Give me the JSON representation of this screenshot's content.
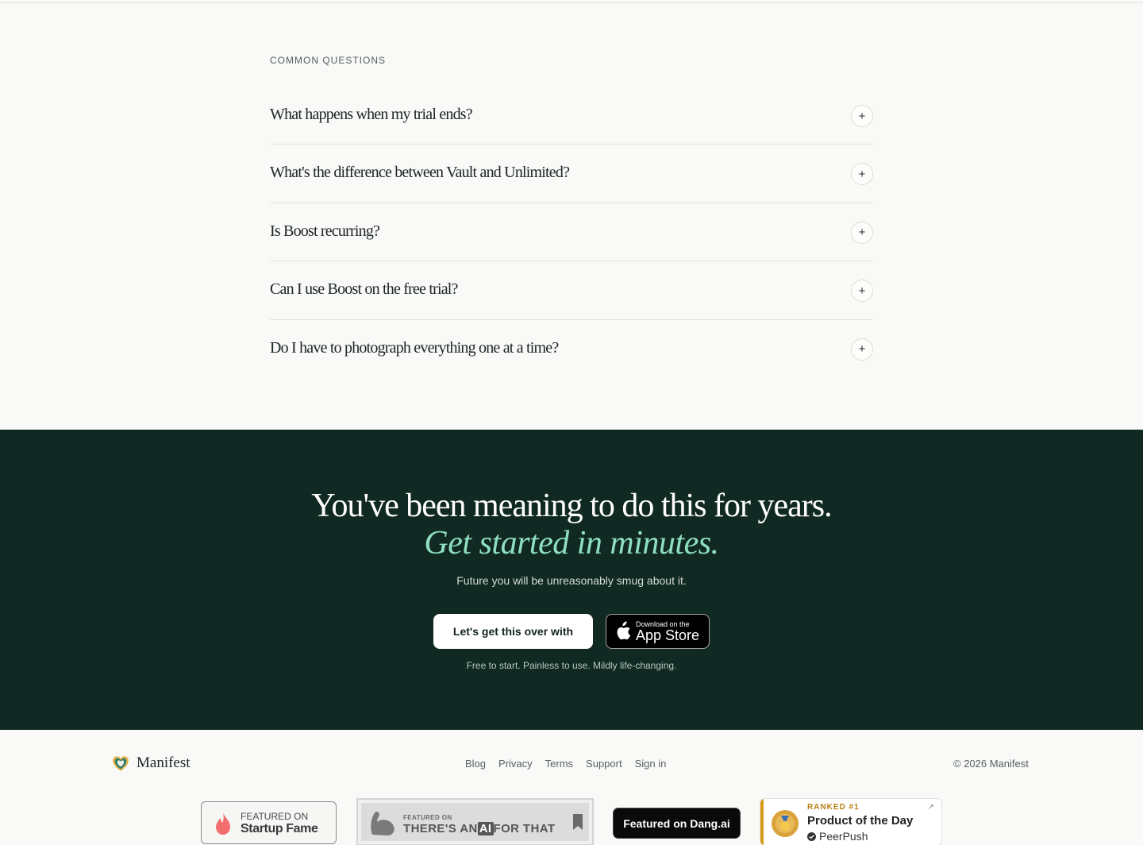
{
  "faq": {
    "kicker": "COMMON QUESTIONS",
    "items": [
      {
        "question": "What happens when my trial ends?"
      },
      {
        "question": "What's the difference between Vault and Unlimited?"
      },
      {
        "question": "Is Boost recurring?"
      },
      {
        "question": "Can I use Boost on the free trial?"
      },
      {
        "question": "Do I have to photograph everything one at a time?"
      }
    ],
    "toggle_glyph": "+"
  },
  "cta": {
    "headline": "You've been meaning to do this for years.",
    "headline_accent": "Get started in minutes.",
    "subtext": "Future you will be unreasonably smug about it.",
    "button_label": "Let's get this over with",
    "appstore_small": "Download on the",
    "appstore_big": "App Store",
    "note": "Free to start. Painless to use. Mildly life-changing.",
    "bg_color": "#112923",
    "accent_color": "#8ee0c0"
  },
  "footer": {
    "brand": "Manifest",
    "links": [
      "Blog",
      "Privacy",
      "Terms",
      "Support",
      "Sign in"
    ],
    "copyright": "© 2026 Manifest",
    "badges": {
      "startup_fame_top": "FEATURED ON",
      "startup_fame_name": "Startup Fame",
      "aitf_small": "FEATURED ON",
      "aitf_big_before": "THERE'S AN",
      "aitf_big_box": "AI",
      "aitf_big_after": "FOR THAT",
      "dang": "Featured on Dang.ai",
      "peerpush_rank": "RANKED #1",
      "peerpush_title": "Product of the Day",
      "peerpush_source": "PeerPush"
    }
  }
}
